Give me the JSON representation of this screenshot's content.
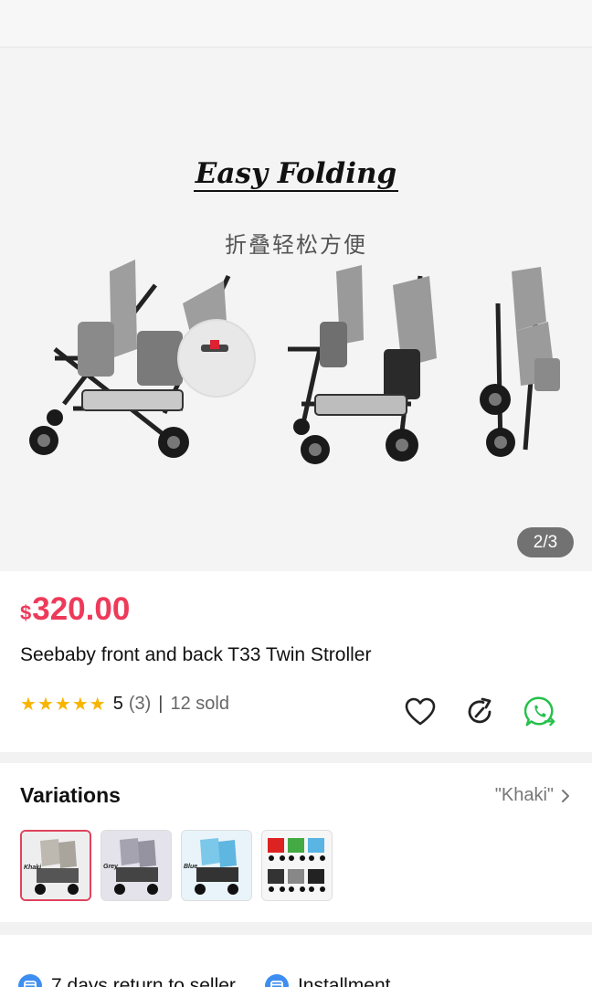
{
  "gallery": {
    "title": "Easy Folding",
    "subtitle": "折叠轻松方便",
    "counter": "2/3"
  },
  "product": {
    "currency": "$",
    "price": "320.00",
    "name": "Seebaby front and back T33 Twin Stroller",
    "rating": "5",
    "reviews": "(3)",
    "separator": "|",
    "sold": "12 sold",
    "stars": 5
  },
  "actions": {
    "favorite_icon": "heart-icon",
    "share_icon": "share-arrow-icon",
    "whatsapp_icon": "whatsapp-icon"
  },
  "variations": {
    "title": "Variations",
    "selected": "\"Khaki\"",
    "options": [
      {
        "label": "Khaki",
        "color": "#bdb8b0"
      },
      {
        "label": "Grey",
        "color": "#a6a3b0"
      },
      {
        "label": "Blue",
        "color": "#7cc8ea"
      },
      {
        "label": "",
        "color": "#f0f0f0"
      }
    ]
  },
  "services": [
    {
      "label": "7 days return to seller",
      "icon": "return-icon"
    },
    {
      "label": "Installment",
      "icon": "installment-icon"
    }
  ],
  "colors": {
    "price": "#ee3a5a",
    "star": "#f7b500",
    "service_icon": "#3d8ef0",
    "whatsapp": "#25c04a"
  }
}
